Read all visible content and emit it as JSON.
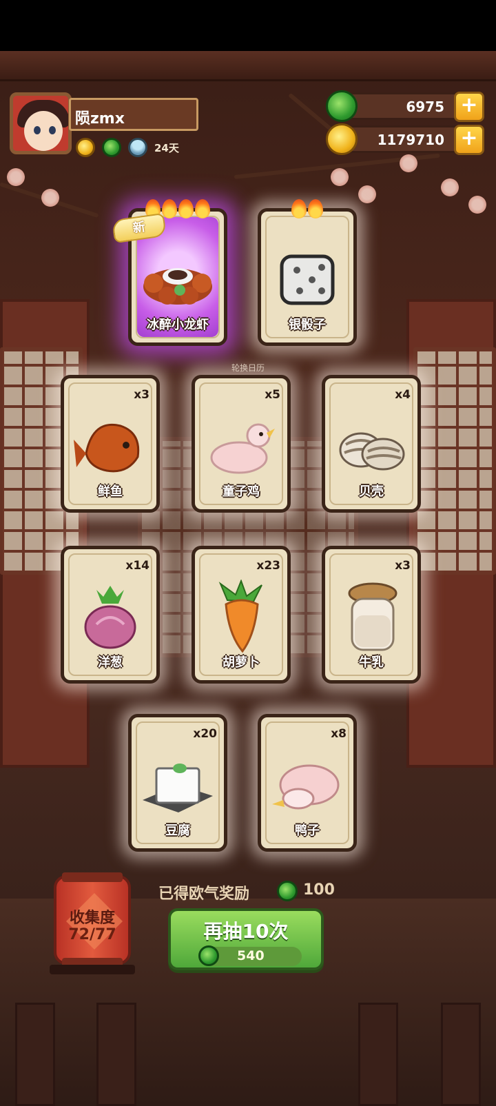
{
  "player": {
    "name": "陨zmx",
    "days": "24天"
  },
  "currency": {
    "jade": "6975",
    "gold": "1179710"
  },
  "badge_new": "新",
  "subtitle": "轮换日历",
  "cards_top": [
    {
      "name": "冰醉小龙虾",
      "flames": 4,
      "rarity": "legendary",
      "new": true
    },
    {
      "name": "银骰子",
      "flames": 2,
      "rarity": "rare"
    }
  ],
  "cards": [
    {
      "name": "鲜鱼",
      "count": "x3"
    },
    {
      "name": "童子鸡",
      "count": "x5"
    },
    {
      "name": "贝壳",
      "count": "x4"
    },
    {
      "name": "洋葱",
      "count": "x14"
    },
    {
      "name": "胡萝卜",
      "count": "x23"
    },
    {
      "name": "牛乳",
      "count": "x3"
    },
    {
      "name": "豆腐",
      "count": "x20"
    },
    {
      "name": "鸭子",
      "count": "x8"
    }
  ],
  "collection": {
    "label": "收集度",
    "progress": "72/77"
  },
  "bonus": {
    "label": "已得欧气奖励",
    "value": "100"
  },
  "draw_button": {
    "label": "再抽10次",
    "cost": "540"
  },
  "colors": {
    "jade": "#2e9a2e",
    "gold": "#f0b21a",
    "legend_glow": "#c85ee8",
    "button_green": "#4fa83a"
  },
  "icons": [
    "jade-coin-icon",
    "gold-coin-icon",
    "plus-icon",
    "flame-icon"
  ]
}
